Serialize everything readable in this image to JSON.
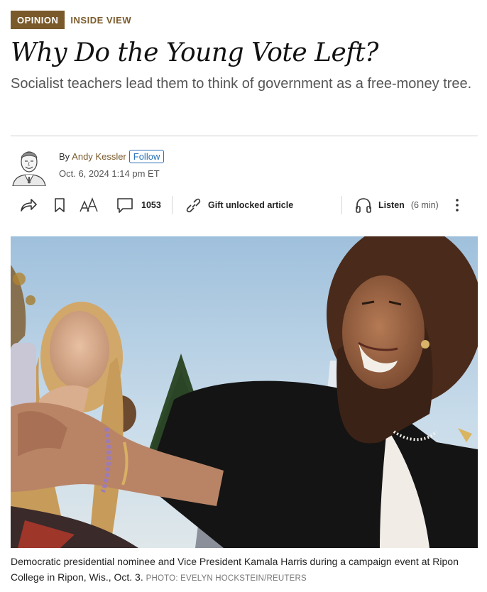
{
  "tags": {
    "opinion": "OPINION",
    "column": "INSIDE VIEW"
  },
  "headline": "Why Do the Young Vote Left?",
  "dek": "Socialist teachers lead them to think of government as a free-money tree.",
  "byline": {
    "by": "By",
    "author": "Andy Kessler",
    "follow": "Follow",
    "date": "Oct. 6, 2024 1:14 pm ET"
  },
  "toolbar": {
    "comments_count": "1053",
    "gift_label": "Gift unlocked article",
    "listen_label": "Listen",
    "listen_duration": "(6 min)",
    "icons": [
      "share-icon",
      "bookmark-icon",
      "text-size-icon",
      "comment-icon",
      "link-icon",
      "headphones-icon",
      "more-icon"
    ]
  },
  "photo": {
    "caption": "Democratic presidential nominee and Vice President Kamala Harris during a campaign event at Ripon College in Ripon, Wis., Oct. 3.",
    "credit": "PHOTO: EVELYN HOCKSTEIN/REUTERS"
  },
  "colors": {
    "accent": "#7a5a2b",
    "link": "#2a73b8",
    "text": "#222222",
    "sky": "#bcd3e6"
  }
}
